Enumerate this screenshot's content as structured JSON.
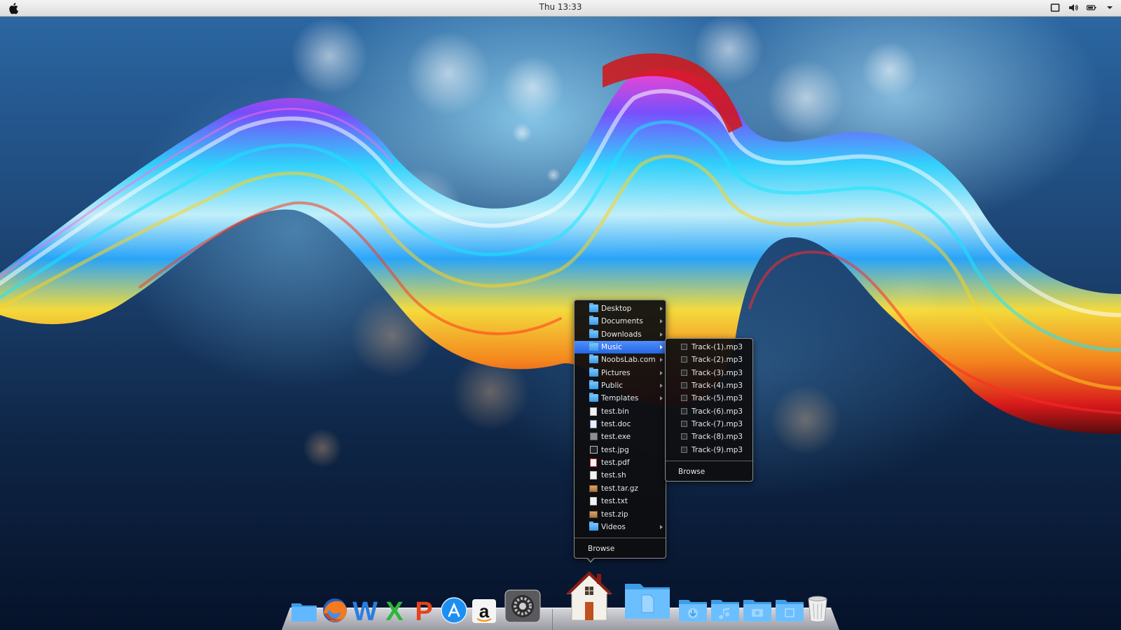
{
  "top_panel": {
    "clock": "Thu 13:33",
    "apple_icon": "apple-icon",
    "tray_icons": [
      "screen-icon",
      "volume-icon",
      "battery-icon",
      "chevron-down-icon"
    ]
  },
  "places_menu": {
    "items": [
      {
        "label": "Desktop",
        "icon": "folder-icon",
        "submenu": true,
        "active": false
      },
      {
        "label": "Documents",
        "icon": "folder-icon",
        "submenu": true,
        "active": false
      },
      {
        "label": "Downloads",
        "icon": "folder-icon",
        "submenu": true,
        "active": false
      },
      {
        "label": "Music",
        "icon": "folder-icon",
        "submenu": true,
        "active": true
      },
      {
        "label": "NoobsLab.com",
        "icon": "folder-icon",
        "submenu": true,
        "active": false
      },
      {
        "label": "Pictures",
        "icon": "folder-icon",
        "submenu": true,
        "active": false
      },
      {
        "label": "Public",
        "icon": "folder-icon",
        "submenu": true,
        "active": false
      },
      {
        "label": "Templates",
        "icon": "folder-icon",
        "submenu": true,
        "active": false
      },
      {
        "label": "test.bin",
        "icon": "file-icon",
        "submenu": false,
        "active": false
      },
      {
        "label": "test.doc",
        "icon": "doc-icon",
        "submenu": false,
        "active": false
      },
      {
        "label": "test.exe",
        "icon": "exe-icon",
        "submenu": false,
        "active": false
      },
      {
        "label": "test.jpg",
        "icon": "image-icon",
        "submenu": false,
        "active": false
      },
      {
        "label": "test.pdf",
        "icon": "pdf-icon",
        "submenu": false,
        "active": false
      },
      {
        "label": "test.sh",
        "icon": "file-icon",
        "submenu": false,
        "active": false
      },
      {
        "label": "test.tar.gz",
        "icon": "archive-icon",
        "submenu": false,
        "active": false
      },
      {
        "label": "test.txt",
        "icon": "file-icon",
        "submenu": false,
        "active": false
      },
      {
        "label": "test.zip",
        "icon": "archive-icon",
        "submenu": false,
        "active": false
      },
      {
        "label": "Videos",
        "icon": "folder-icon",
        "submenu": true,
        "active": false
      }
    ],
    "browse_label": "Browse"
  },
  "music_menu": {
    "items": [
      {
        "label": "Track-(1).mp3",
        "icon": "audio-file-icon"
      },
      {
        "label": "Track-(2).mp3",
        "icon": "audio-file-icon"
      },
      {
        "label": "Track-(3).mp3",
        "icon": "audio-file-icon"
      },
      {
        "label": "Track-(4).mp3",
        "icon": "audio-file-icon"
      },
      {
        "label": "Track-(5).mp3",
        "icon": "audio-file-icon"
      },
      {
        "label": "Track-(6).mp3",
        "icon": "audio-file-icon"
      },
      {
        "label": "Track-(7).mp3",
        "icon": "audio-file-icon"
      },
      {
        "label": "Track-(8).mp3",
        "icon": "audio-file-icon"
      },
      {
        "label": "Track-(9).mp3",
        "icon": "audio-file-icon"
      }
    ],
    "browse_label": "Browse"
  },
  "dock": {
    "items": [
      {
        "name": "files-icon"
      },
      {
        "name": "firefox-icon"
      },
      {
        "name": "writer-icon",
        "glyph": "W"
      },
      {
        "name": "calc-icon",
        "glyph": "X"
      },
      {
        "name": "impress-icon",
        "glyph": "P"
      },
      {
        "name": "app-store-icon"
      },
      {
        "name": "amazon-icon",
        "glyph": "a"
      },
      {
        "name": "system-settings-icon"
      },
      {
        "name": "home-folder-icon"
      },
      {
        "name": "documents-folder-icon"
      },
      {
        "name": "downloads-folder-icon"
      },
      {
        "name": "music-folder-icon"
      },
      {
        "name": "pictures-folder-icon"
      },
      {
        "name": "videos-folder-icon"
      },
      {
        "name": "trash-icon"
      }
    ]
  },
  "colors": {
    "menu_highlight": "#3a7cf2",
    "folder_blue": "#5bb2f5"
  }
}
